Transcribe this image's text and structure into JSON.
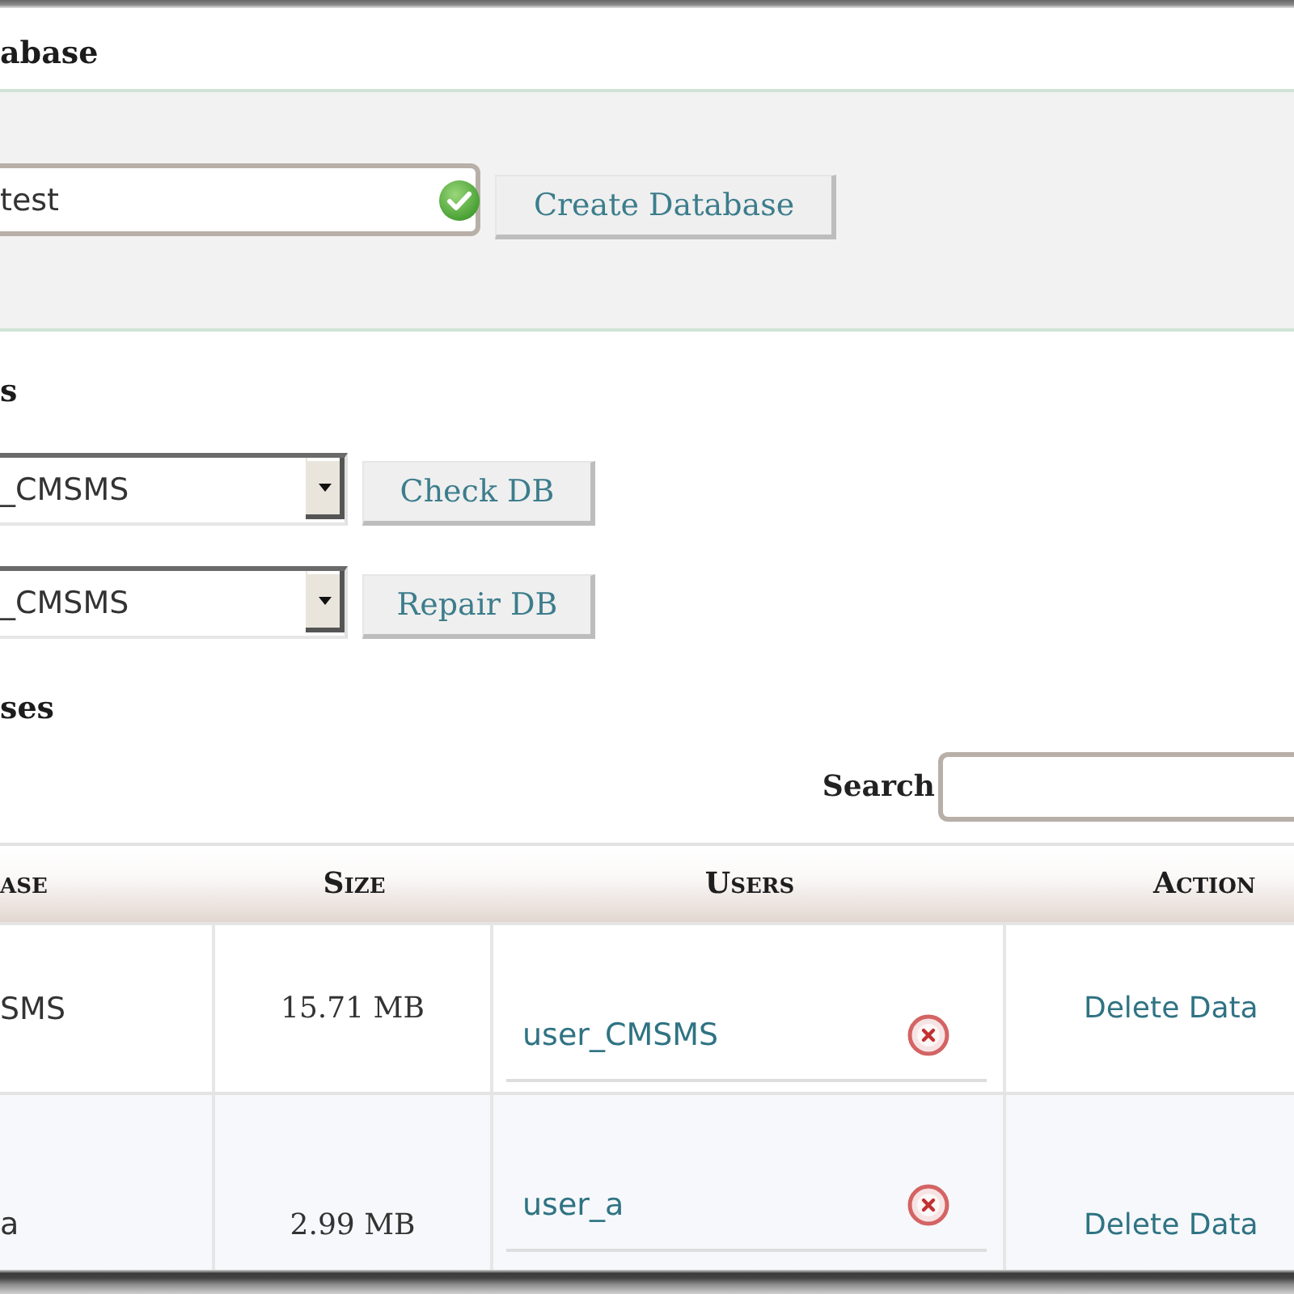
{
  "create_section": {
    "heading": "abase",
    "name_field": {
      "value": "test",
      "valid": true
    },
    "button": "Create Database"
  },
  "modify_section": {
    "heading": "s",
    "rows": [
      {
        "value": "_CMSMS",
        "button": "Check DB"
      },
      {
        "value": "_CMSMS",
        "button": "Repair DB"
      }
    ]
  },
  "current_section": {
    "heading": "ses",
    "search": {
      "label": "Search"
    },
    "table": {
      "columns": [
        "ase",
        "Size",
        "Users",
        "Action"
      ],
      "rows": [
        {
          "database": "SMS",
          "size": "15.71 MB",
          "users": [
            {
              "name": "user_CMSMS"
            }
          ],
          "action": "Delete Data"
        },
        {
          "database": "a",
          "size": "2.99 MB",
          "users": [
            {
              "name": "user_a"
            }
          ],
          "action": "Delete Data"
        }
      ]
    }
  }
}
